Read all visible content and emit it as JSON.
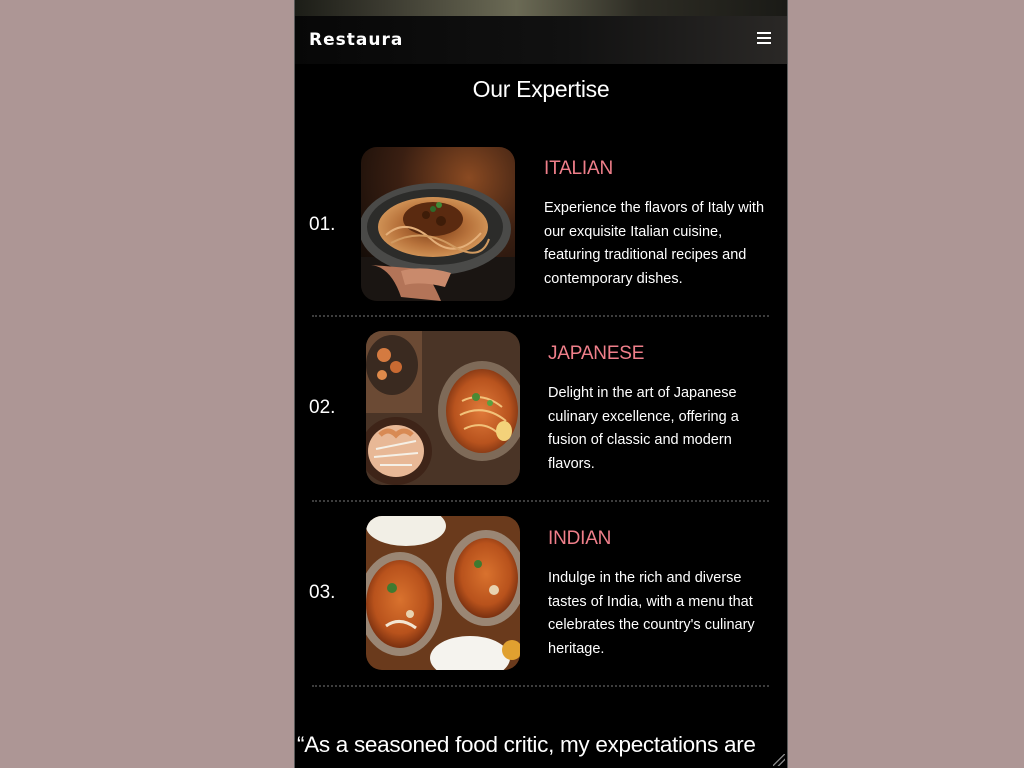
{
  "header": {
    "brand": "Restaura",
    "menu_icon": "hamburger-menu-icon"
  },
  "expertise": {
    "title": "Our Expertise",
    "items": [
      {
        "number": "01.",
        "title": "ITALIAN",
        "description": "Experience the flavors of Italy with our exquisite Italian cuisine, featuring traditional recipes and contemporary dishes.",
        "image": "italian-pasta-photo"
      },
      {
        "number": "02.",
        "title": "JAPANESE",
        "description": "Delight in the art of Japanese culinary excellence, offering a fusion of classic and modern flavors.",
        "image": "japanese-ramen-photo"
      },
      {
        "number": "03.",
        "title": "INDIAN",
        "description": "Indulge in the rich and diverse tastes of India, with a menu that celebrates the country's culinary heritage.",
        "image": "indian-curry-photo"
      }
    ]
  },
  "testimonial": {
    "quote_start": "“As a seasoned food critic, my expectations are"
  },
  "colors": {
    "accent": "#ef7f8a",
    "background": "#000000",
    "page_backdrop": "#ad9695"
  }
}
